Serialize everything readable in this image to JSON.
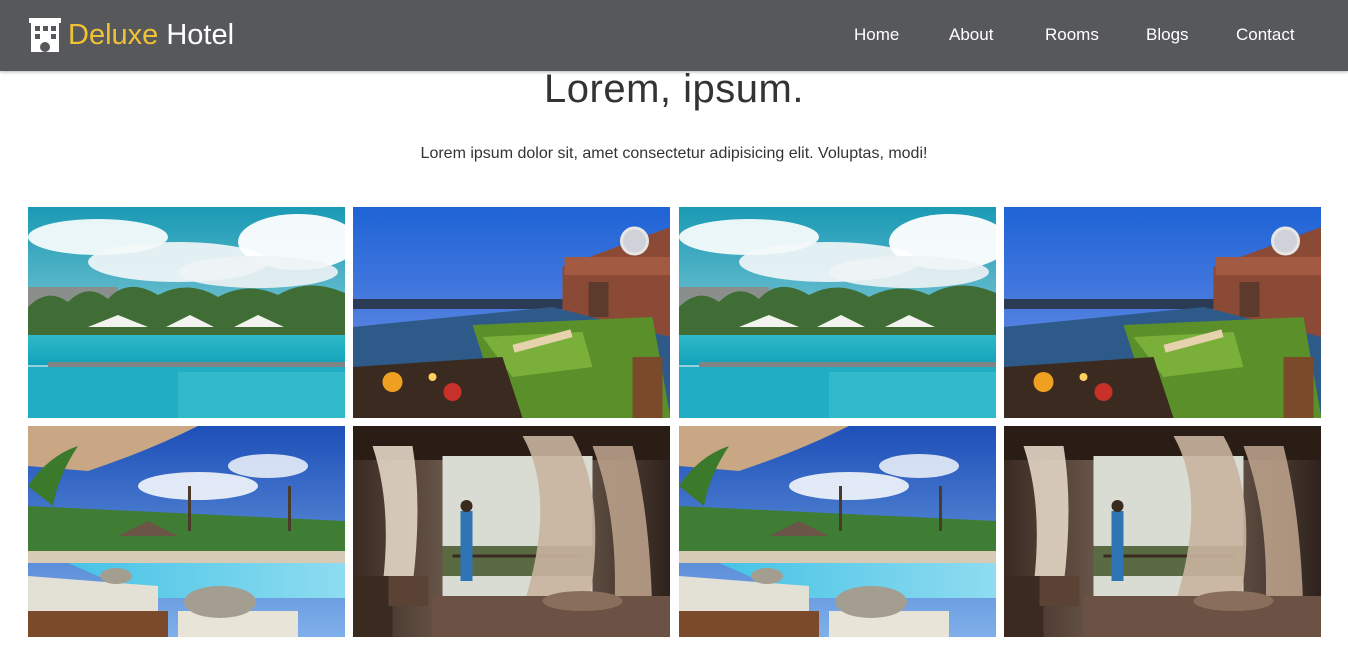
{
  "brand": {
    "accent": "Deluxe",
    "rest": "Hotel",
    "icon": "hotel-building-icon",
    "accent_color": "#f1c232"
  },
  "nav": {
    "links": [
      "Home",
      "About",
      "Rooms",
      "Blogs",
      "Contact"
    ],
    "background": "#57585c"
  },
  "hero": {
    "title": "Lorem, ipsum.",
    "subtitle": "Lorem ipsum dolor sit, amet consectetur adipisicing elit. Voluptas, modi!"
  },
  "gallery": {
    "photos": [
      "daytime-pool-photo",
      "sunset-terrace-photo",
      "daytime-pool-photo",
      "sunset-terrace-photo",
      "tropical-pool-photo",
      "canopy-bedroom-photo",
      "tropical-pool-photo",
      "canopy-bedroom-photo"
    ]
  }
}
